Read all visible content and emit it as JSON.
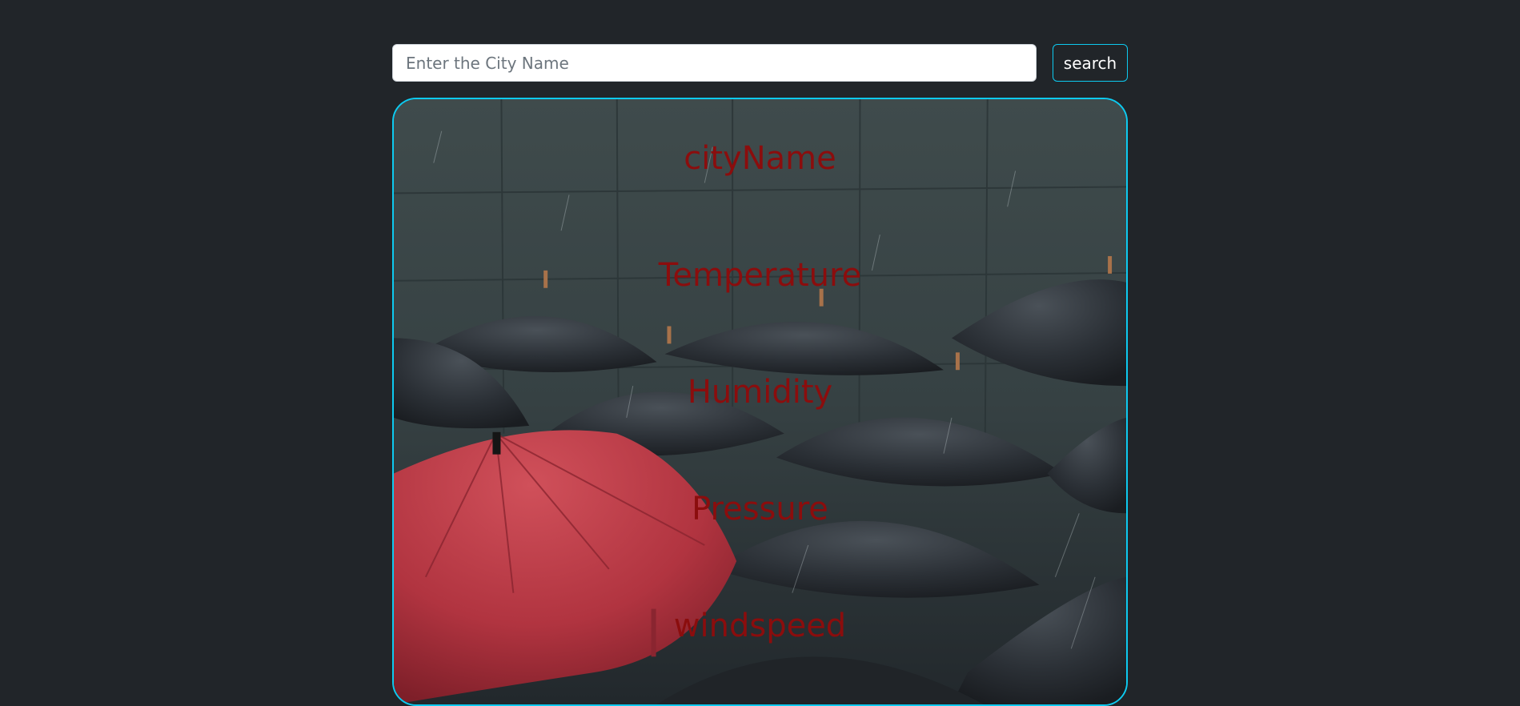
{
  "search": {
    "placeholder": "Enter the City Name",
    "value": "",
    "button_label": "search"
  },
  "card": {
    "background_image": "rain-umbrellas",
    "fields": {
      "city_name": "cityName",
      "temperature": "Temperature",
      "humidity": "Humidity",
      "pressure": "Pressure",
      "windspeed": "windspeed"
    }
  },
  "colors": {
    "page_bg": "#212529",
    "accent_border": "#0dcaf0",
    "field_text": "#8b0d0d"
  }
}
